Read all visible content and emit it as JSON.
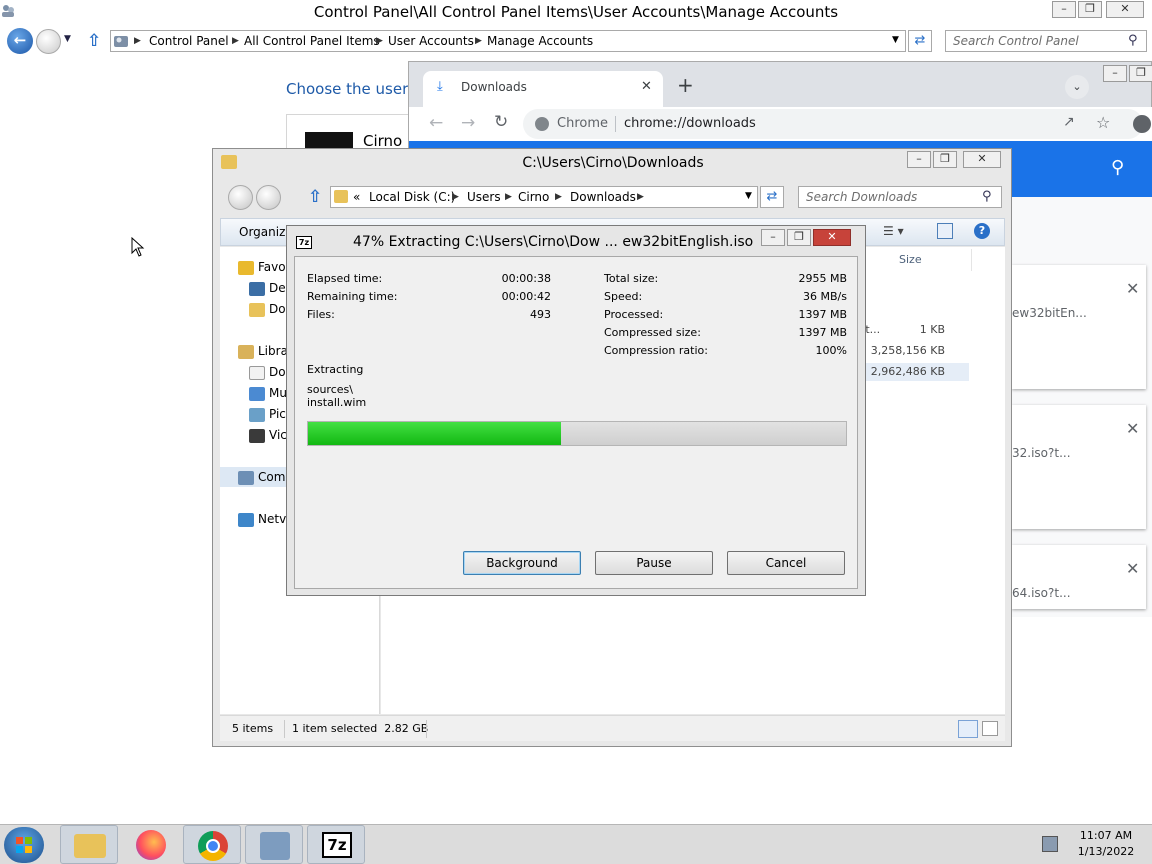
{
  "control_panel": {
    "title": "Control Panel\\All Control Panel Items\\User Accounts\\Manage Accounts",
    "breadcrumbs": [
      "Control Panel",
      "All Control Panel Items",
      "User Accounts",
      "Manage Accounts"
    ],
    "search_placeholder": "Search Control Panel",
    "heading": "Choose the user y",
    "account_name": "Cirno"
  },
  "chrome": {
    "tab_title": "Downloads",
    "new_tab": "+",
    "site_chip": "Chrome",
    "url": "chrome://downloads",
    "downloads": [
      {
        "name": "ew32bitEn..."
      },
      {
        "name": "32.iso?t..."
      },
      {
        "name": "64.iso?t..."
      }
    ]
  },
  "explorer": {
    "title": "C:\\Users\\Cirno\\Downloads",
    "breadcrumbs": [
      "«",
      "Local Disk (C:)",
      "Users",
      "Cirno",
      "Downloads"
    ],
    "search_placeholder": "Search Downloads",
    "organize_label": "Organize",
    "column_size": "Size",
    "nav": [
      {
        "label": "Favo",
        "icon": "star-icon"
      },
      {
        "label": "De",
        "icon": "desktop-icon"
      },
      {
        "label": "Do",
        "icon": "downloads-folder-icon"
      },
      {
        "label": "Libra",
        "icon": "libraries-icon"
      },
      {
        "label": "Do",
        "icon": "documents-icon"
      },
      {
        "label": "Mu",
        "icon": "music-icon"
      },
      {
        "label": "Pic",
        "icon": "pictures-icon"
      },
      {
        "label": "Vic",
        "icon": "videos-icon"
      },
      {
        "label": "Com",
        "icon": "computer-icon"
      },
      {
        "label": "Netv",
        "icon": "network-icon"
      }
    ],
    "file_rows": [
      {
        "name": "tt...",
        "size": "1 KB"
      },
      {
        "name": "",
        "size": "3,258,156 KB"
      },
      {
        "name": "",
        "size": "2,962,486 KB"
      }
    ],
    "status_items": "5 items",
    "status_selected": "1 item selected  2.82 GB"
  },
  "sevenzip": {
    "title": "47% Extracting C:\\Users\\Cirno\\Dow ... ew32bitEnglish.iso",
    "progress_percent": 47,
    "left_labels": [
      {
        "label": "Elapsed time:",
        "value": "00:00:38"
      },
      {
        "label": "Remaining time:",
        "value": "00:00:42"
      },
      {
        "label": "Files:",
        "value": "493"
      }
    ],
    "right_labels": [
      {
        "label": "Total size:",
        "value": "2955 MB"
      },
      {
        "label": "Speed:",
        "value": "36 MB/s"
      },
      {
        "label": "Processed:",
        "value": "1397 MB"
      },
      {
        "label": "Compressed size:",
        "value": "1397 MB"
      },
      {
        "label": "Compression ratio:",
        "value": "100%"
      }
    ],
    "extracting_label": "Extracting",
    "path_line1": "sources\\",
    "path_line2": "install.wim",
    "buttons": {
      "background": "Background",
      "pause": "Pause",
      "cancel": "Cancel"
    }
  },
  "taskbar": {
    "time": "11:07 AM",
    "date": "1/13/2022",
    "sevenzip_label": "7z"
  },
  "colors": {
    "progress_green": "#1fc61f",
    "chrome_blue": "#1a73e8",
    "link_blue": "#1e5aa8",
    "taskbar": "#dcdcdc"
  }
}
